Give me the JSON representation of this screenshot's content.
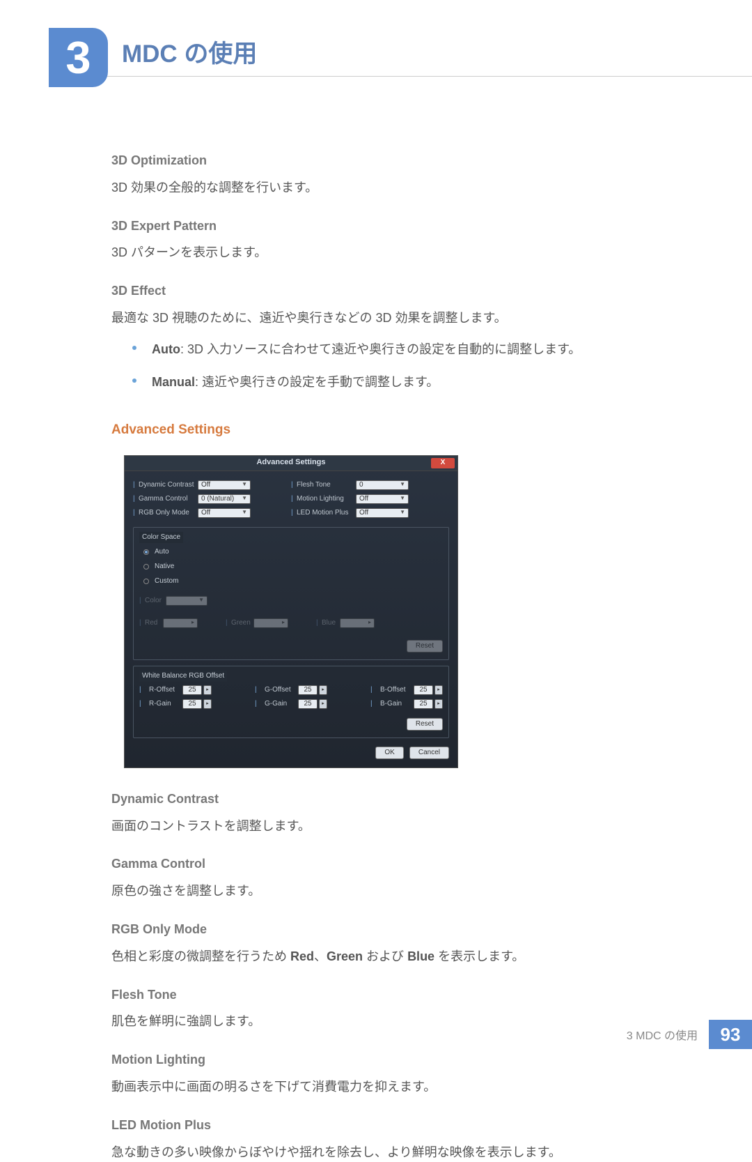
{
  "chapter": {
    "number": "3",
    "title": "MDC の使用"
  },
  "sections": {
    "opt3d_h": "3D Optimization",
    "opt3d_p": "3D 効果の全般的な調整を行います。",
    "exp3d_h": "3D Expert Pattern",
    "exp3d_p": "3D パターンを表示します。",
    "eff3d_h": "3D Effect",
    "eff3d_p": "最適な 3D 視聴のために、遠近や奥行きなどの 3D 効果を調整します。",
    "bullets": [
      {
        "b": "Auto",
        "t": ": 3D 入力ソースに合わせて遠近や奥行きの設定を自動的に調整します。"
      },
      {
        "b": "Manual",
        "t": ": 遠近や奥行きの設定を手動で調整します。"
      }
    ],
    "adv_title": "Advanced Settings"
  },
  "dialog": {
    "title": "Advanced Settings",
    "close": "X",
    "left": [
      {
        "label": "Dynamic Contrast",
        "value": "Off"
      },
      {
        "label": "Gamma Control",
        "value": "0 (Natural)"
      },
      {
        "label": "RGB Only Mode",
        "value": "Off"
      }
    ],
    "right": [
      {
        "label": "Flesh Tone",
        "value": "0"
      },
      {
        "label": "Motion Lighting",
        "value": "Off"
      },
      {
        "label": "LED Motion Plus",
        "value": "Off"
      }
    ],
    "colorspace": {
      "title": "Color Space",
      "options": [
        "Auto",
        "Native",
        "Custom"
      ],
      "disabled": {
        "color": "Color",
        "red": "Red",
        "green": "Green",
        "blue": "Blue"
      },
      "reset": "Reset"
    },
    "wb": {
      "title": "White Balance RGB Offset",
      "rows": [
        [
          {
            "label": "R-Offset",
            "val": "25"
          },
          {
            "label": "G-Offset",
            "val": "25"
          },
          {
            "label": "B-Offset",
            "val": "25"
          }
        ],
        [
          {
            "label": "R-Gain",
            "val": "25"
          },
          {
            "label": "G-Gain",
            "val": "25"
          },
          {
            "label": "B-Gain",
            "val": "25"
          }
        ]
      ],
      "reset": "Reset"
    },
    "ok": "OK",
    "cancel": "Cancel"
  },
  "descriptions": {
    "dynamic_h": "Dynamic Contrast",
    "dynamic_p": "画面のコントラストを調整します。",
    "gamma_h": "Gamma Control",
    "gamma_p": "原色の強さを調整します。",
    "rgb_h": "RGB Only Mode",
    "rgb_p_pre": "色相と彩度の微調整を行うため ",
    "rgb_b1": "Red",
    "rgb_mid1": "、",
    "rgb_b2": "Green",
    "rgb_mid2": " および ",
    "rgb_b3": "Blue",
    "rgb_suf": " を表示します。",
    "flesh_h": "Flesh Tone",
    "flesh_p": "肌色を鮮明に強調します。",
    "motion_h": "Motion Lighting",
    "motion_p": "動画表示中に画面の明るさを下げて消費電力を抑えます。",
    "led_h": "LED Motion Plus",
    "led_p": "急な動きの多い映像からぼやけや揺れを除去し、より鮮明な映像を表示します。"
  },
  "footer": {
    "text": "3 MDC の使用",
    "page": "93"
  }
}
